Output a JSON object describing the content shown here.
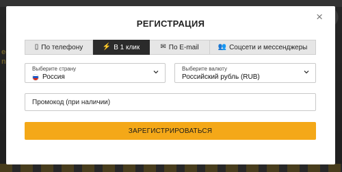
{
  "background": {
    "line1": "ec",
    "line2": "nd"
  },
  "modal": {
    "title": "РЕГИСТРАЦИЯ",
    "close_glyph": "×"
  },
  "tabs": [
    {
      "label": "По телефону",
      "icon": "phone-icon",
      "glyph": "▯",
      "active": false
    },
    {
      "label": "В 1 клик",
      "icon": "lightning-icon",
      "glyph": "⚡",
      "active": true
    },
    {
      "label": "По E-mail",
      "icon": "envelope-icon",
      "glyph": "✉",
      "active": false
    },
    {
      "label": "Соцсети и мессенджеры",
      "icon": "users-icon",
      "glyph": "👥",
      "active": false
    }
  ],
  "country": {
    "label": "Выберите страну",
    "value": "Россия"
  },
  "currency": {
    "label": "Выберите валюту",
    "value": "Российский рубль (RUB)"
  },
  "promo": {
    "placeholder": "Промокод (при наличии)",
    "value": ""
  },
  "submit": {
    "label": "ЗАРЕГИСТРИРОВАТЬСЯ"
  },
  "colors": {
    "accent": "#f4a818",
    "active_tab": "#2b2b2b",
    "tab_bg": "#e6e6e6"
  }
}
